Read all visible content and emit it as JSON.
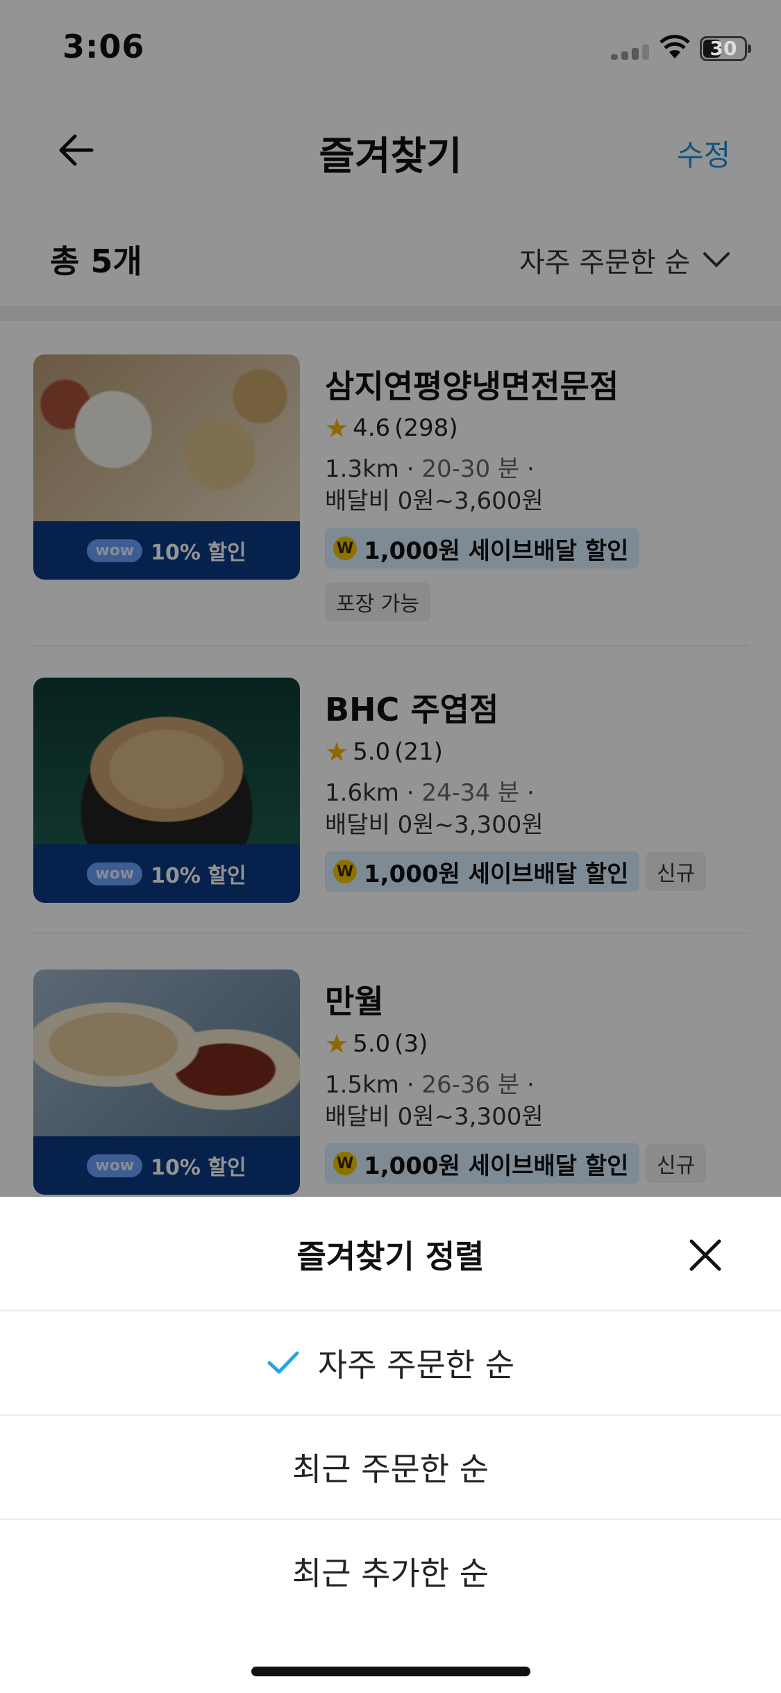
{
  "status": {
    "time": "3:06",
    "battery": "30"
  },
  "header": {
    "title": "즐겨찾기",
    "edit_label": "수정"
  },
  "toolbar": {
    "count": "총 5개",
    "sort_label": "자주 주문한 순"
  },
  "stores": [
    {
      "name": "삼지연평양냉면전문점",
      "rating": "4.6",
      "reviews": "(298)",
      "distance": "1.3km",
      "time": "20-30 분",
      "fee": "배달비 0원~3,600원",
      "coupon": "1,000원 세이브배달 할인",
      "tag": "포장 가능",
      "wow_badge": "wow",
      "discount": "10% 할인"
    },
    {
      "name": "BHC 주엽점",
      "rating": "5.0",
      "reviews": "(21)",
      "distance": "1.6km",
      "time": "24-34 분",
      "fee": "배달비 0원~3,300원",
      "coupon": "1,000원 세이브배달 할인",
      "tag": "신규",
      "wow_badge": "wow",
      "discount": "10% 할인"
    },
    {
      "name": "만월",
      "rating": "5.0",
      "reviews": "(3)",
      "distance": "1.5km",
      "time": "26-36 분",
      "fee": "배달비 0원~3,300원",
      "coupon": "1,000원 세이브배달 할인",
      "tag": "신규",
      "wow_badge": "wow",
      "discount": "10% 할인"
    }
  ],
  "sheet": {
    "title": "즐겨찾기 정렬",
    "options": [
      {
        "label": "자주 주문한 순",
        "selected": true
      },
      {
        "label": "최근 주문한 순",
        "selected": false
      },
      {
        "label": "최근 추가한 순",
        "selected": false
      }
    ]
  },
  "colors": {
    "accent": "#1c8fe0",
    "wow_band": "#0b3a82",
    "coupon_bg": "#d9eeff",
    "check": "#1fa7ea"
  }
}
